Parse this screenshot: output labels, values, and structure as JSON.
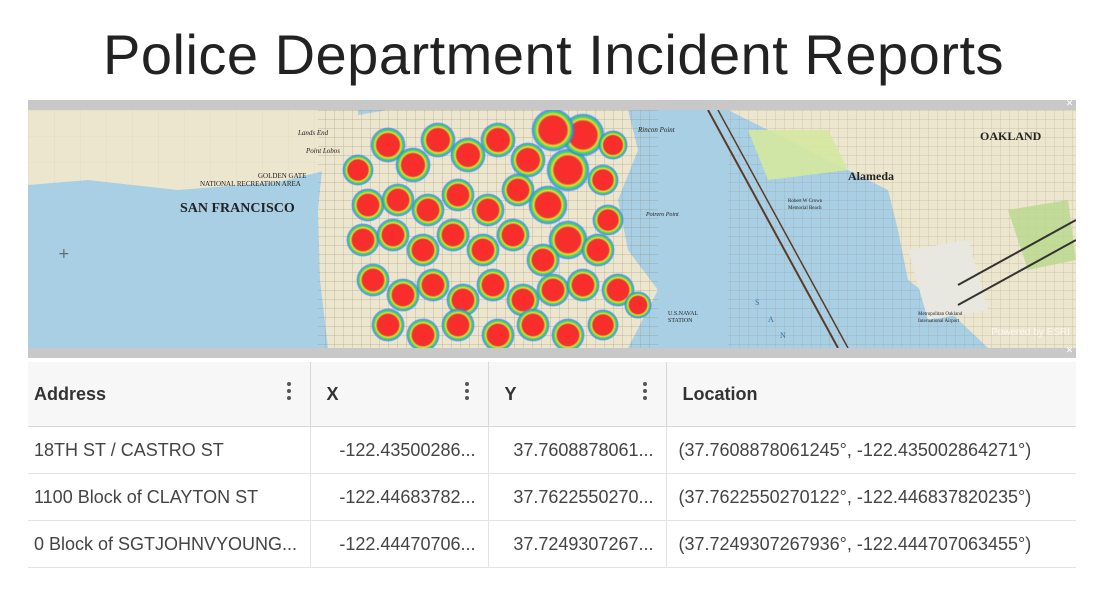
{
  "title": "Police Department Incident Reports",
  "map": {
    "labels": {
      "san_francisco": "SAN FRANCISCO",
      "golden_gate": "GOLDEN GATE",
      "nra": "NATIONAL RECREATION AREA",
      "lands_end": "Lands End",
      "point_lobos": "Point Lobos",
      "rincon_point": "Rincon Point",
      "potrero_point": "Potrero Point",
      "us_naval": "U.S.NAVAL",
      "station": "STATION",
      "oakland": "OAKLAND",
      "alameda": "Alameda",
      "airport": "Metropolitan Oakland",
      "airport2": "International Airport",
      "robert_crown": "Robert W Crown",
      "memorial_beach": "Memorial Beach",
      "bay_s": "S",
      "bay_a": "A",
      "bay_n": "N",
      "watermark": "Powered by ESRI"
    },
    "colors": {
      "water": "#a9cfe4",
      "land": "#ede6cf",
      "heat_outer": "#3c7cff",
      "heat_mid": "#38e04a",
      "heat_core": "#f0322e"
    }
  },
  "table": {
    "columns": [
      {
        "label": "Address"
      },
      {
        "label": "X"
      },
      {
        "label": "Y"
      },
      {
        "label": "Location"
      }
    ],
    "rows": [
      {
        "address": "18TH ST / CASTRO ST",
        "x": "-122.43500286...",
        "y": "37.7608878061...",
        "location": "(37.7608878061245°, -122.435002864271°)"
      },
      {
        "address": "1100 Block of CLAYTON ST",
        "x": "-122.44683782...",
        "y": "37.7622550270...",
        "location": "(37.7622550270122°, -122.446837820235°)"
      },
      {
        "address": "0 Block of SGTJOHNVYOUNG...",
        "x": "-122.44470706...",
        "y": "37.7249307267...",
        "location": "(37.7249307267936°, -122.444707063455°)"
      }
    ]
  }
}
